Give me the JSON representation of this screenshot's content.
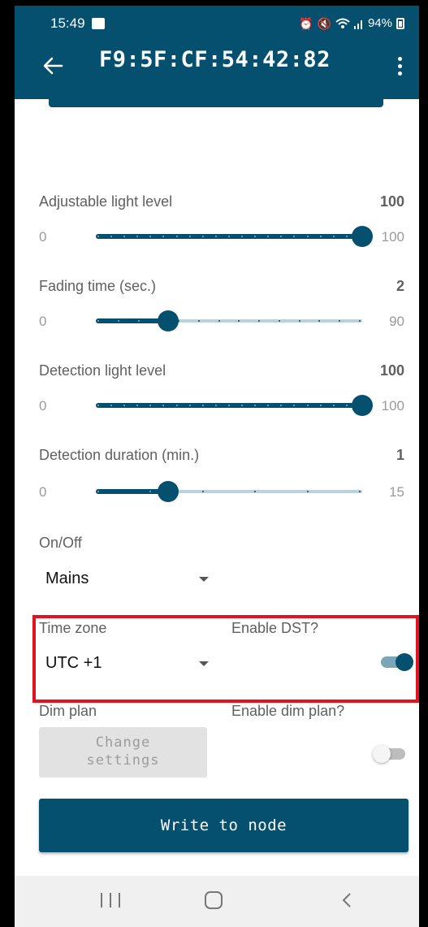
{
  "status_bar": {
    "time": "15:49",
    "battery": "94%",
    "icons": [
      "image-icon",
      "alarm-icon",
      "mute-icon",
      "wifi-icon",
      "signal-icon",
      "battery-icon"
    ]
  },
  "app_bar": {
    "title": "F9:5F:CF:54:42:82",
    "back_icon": "arrow-left-icon",
    "menu_icon": "more-vertical-icon"
  },
  "settings": [
    {
      "id": "adjustable",
      "label": "Adjustable light level",
      "value": "100",
      "min": "0",
      "max": "100",
      "fraction": 1.0,
      "ticks": 21
    },
    {
      "id": "fading",
      "label": "Fading time (sec.)",
      "value": "2",
      "min": "0",
      "max": "90",
      "fraction": 0.27,
      "ticks": 14
    },
    {
      "id": "detection_level",
      "label": "Detection light level",
      "value": "100",
      "min": "0",
      "max": "100",
      "fraction": 1.0,
      "ticks": 21
    },
    {
      "id": "detection_duration",
      "label": "Detection duration (min.)",
      "value": "1",
      "min": "0",
      "max": "15",
      "fraction": 0.27,
      "ticks": 6
    }
  ],
  "onoff": {
    "label": "On/Off",
    "value": "Mains"
  },
  "timezone": {
    "label": "Time zone",
    "value": "UTC +1",
    "dst_label": "Enable DST?",
    "dst_enabled": true
  },
  "dimplan": {
    "label": "Dim plan",
    "enable_label": "Enable dim plan?",
    "enabled": false,
    "change_line1": "Change",
    "change_line2": "settings"
  },
  "write_button": "Write to node",
  "colors": {
    "primary": "#05506f",
    "highlight": "#e0131f",
    "track_inactive": "#b8d3df"
  }
}
